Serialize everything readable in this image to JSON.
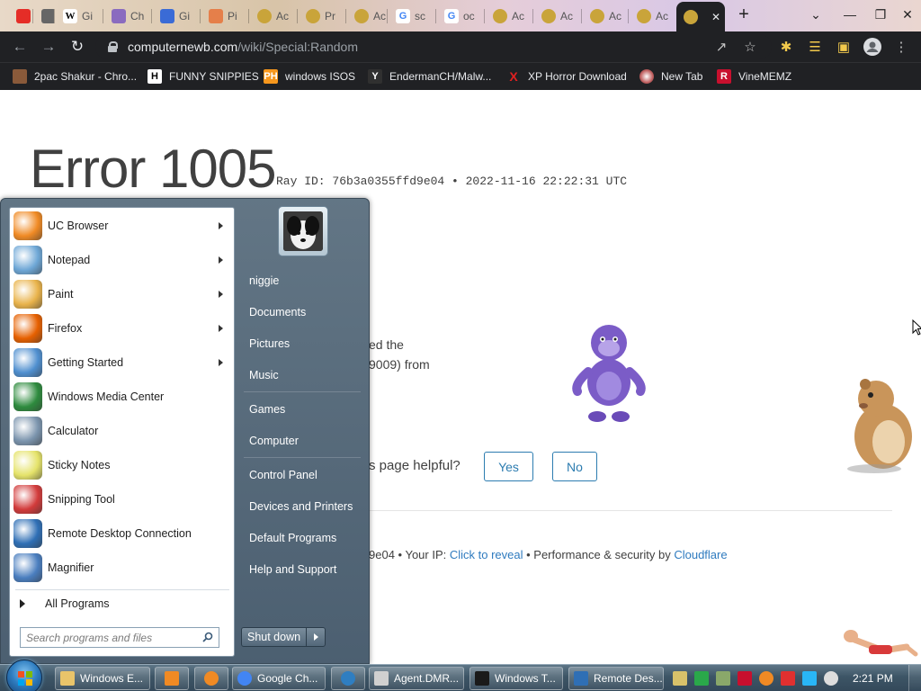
{
  "browser": {
    "address": {
      "host": "computernewb.com",
      "path": "/wiki/Special:Random"
    },
    "tabs": [
      {
        "title": "",
        "favicon": "youtube-icon",
        "color": "#e52d27"
      },
      {
        "title": "",
        "favicon": "mute-icon",
        "color": "#666666"
      },
      {
        "title": "Gi",
        "favicon": "wikipedia-icon",
        "color": "#ffffff"
      },
      {
        "title": "Ch",
        "favicon": "pen-icon",
        "color": "#8a6bbf"
      },
      {
        "title": "Gi",
        "favicon": "pen-icon",
        "color": "#3a6bd6"
      },
      {
        "title": "Pi",
        "favicon": "rainbow-icon",
        "color": "#e57f4a"
      },
      {
        "title": "Ac",
        "favicon": "cloudflare-icon",
        "color": "#c9a43a"
      },
      {
        "title": "Pr",
        "favicon": "cloudflare-icon",
        "color": "#c9a43a"
      },
      {
        "title": "Ac",
        "favicon": "cloudflare-icon",
        "color": "#c9a43a"
      },
      {
        "title": "sc",
        "favicon": "google-icon",
        "color": "#4285f4"
      },
      {
        "title": "oc",
        "favicon": "google-icon",
        "color": "#4285f4"
      },
      {
        "title": "Ac",
        "favicon": "cloudflare-icon",
        "color": "#c9a43a"
      },
      {
        "title": "Ac",
        "favicon": "cloudflare-icon",
        "color": "#c9a43a"
      },
      {
        "title": "Ac",
        "favicon": "cloudflare-icon",
        "color": "#c9a43a"
      },
      {
        "title": "Ac",
        "favicon": "cloudflare-icon",
        "color": "#c9a43a"
      },
      {
        "title": "",
        "favicon": "cloudflare-icon",
        "color": "#c9a43a",
        "active": true
      }
    ],
    "new_tab_symbol": "+",
    "close_symbol": "✕",
    "bookmarks": [
      {
        "label": "2pac Shakur - Chro...",
        "icon": "folder-person-icon",
        "color": "#8a5a3a"
      },
      {
        "label": "FUNNY SNIPPIES",
        "icon": "h-icon",
        "glyph": "H",
        "color": "#ffffff"
      },
      {
        "label": "windows ISOS",
        "icon": "ph-icon",
        "glyph": "PH",
        "color": "#f7971d"
      },
      {
        "label": "EndermanCH/Malw...",
        "icon": "yp-icon",
        "glyph": "Y",
        "color": "#303030"
      },
      {
        "label": "XP Horror Download",
        "icon": "x-icon",
        "glyph": "X",
        "color": "#e02020"
      },
      {
        "label": "New Tab",
        "icon": "globe-icon",
        "glyph": "",
        "color": "#c06060"
      },
      {
        "label": "VineMEMZ",
        "icon": "r-icon",
        "glyph": "R",
        "color": "#c8102e"
      }
    ]
  },
  "page": {
    "error_title": "Error 1005",
    "ray_id": "Ray ID: 76b3a0355ffd9e04 • 2022-11-16 22:22:31 UTC",
    "frag1": "ed the",
    "frag2": "9009) from",
    "helpful_q": "s page helpful?",
    "yes": "Yes",
    "no": "No",
    "footer_id": "9e04",
    "footer_ip": " • Your IP: ",
    "footer_reveal": "Click to reveal",
    "footer_perf": " • Performance & security by ",
    "footer_cf": "Cloudflare"
  },
  "startmenu": {
    "programs": [
      {
        "label": "UC Browser",
        "icon": "uc-browser-icon",
        "arrow": true,
        "color": "#f08a24"
      },
      {
        "label": "Notepad",
        "icon": "notepad-icon",
        "arrow": true,
        "color": "#6ea7d6"
      },
      {
        "label": "Paint",
        "icon": "paint-icon",
        "arrow": true,
        "color": "#e9b34b"
      },
      {
        "label": "Firefox",
        "icon": "firefox-icon",
        "arrow": true,
        "color": "#e66000"
      },
      {
        "label": "Getting Started",
        "icon": "getting-started-icon",
        "arrow": true,
        "color": "#4f8fcf"
      },
      {
        "label": "Windows Media Center",
        "icon": "media-center-icon",
        "arrow": false,
        "color": "#2e8b3e"
      },
      {
        "label": "Calculator",
        "icon": "calculator-icon",
        "arrow": false,
        "color": "#7b94ad"
      },
      {
        "label": "Sticky Notes",
        "icon": "sticky-notes-icon",
        "arrow": false,
        "color": "#e5e36a"
      },
      {
        "label": "Snipping Tool",
        "icon": "snipping-tool-icon",
        "arrow": false,
        "color": "#d23b3b"
      },
      {
        "label": "Remote Desktop Connection",
        "icon": "remote-desktop-icon",
        "arrow": false,
        "color": "#2f6fb5"
      },
      {
        "label": "Magnifier",
        "icon": "magnifier-icon",
        "arrow": false,
        "color": "#4a7ebf"
      }
    ],
    "all_programs": "All Programs",
    "search_placeholder": "Search programs and files",
    "right": [
      {
        "label": "niggie",
        "name": "user-name"
      },
      {
        "label": "Documents",
        "name": "documents"
      },
      {
        "label": "Pictures",
        "name": "pictures"
      },
      {
        "label": "Music",
        "name": "music"
      },
      {
        "label": "Games",
        "name": "games"
      },
      {
        "label": "Computer",
        "name": "computer"
      },
      {
        "label": "Control Panel",
        "name": "control-panel"
      },
      {
        "label": "Devices and Printers",
        "name": "devices-and-printers"
      },
      {
        "label": "Default Programs",
        "name": "default-programs"
      },
      {
        "label": "Help and Support",
        "name": "help-and-support"
      }
    ],
    "shutdown": "Shut down"
  },
  "taskbar": {
    "tasks": [
      {
        "label": "Windows E...",
        "icon": "explorer-icon",
        "color": "#e9c46a"
      },
      {
        "label": "",
        "icon": "media-player-icon",
        "color": "#f08a24"
      },
      {
        "label": "",
        "icon": "uc-browser-icon",
        "color": "#f08a24"
      },
      {
        "label": "Google Ch...",
        "icon": "chrome-icon",
        "color": "#4285f4"
      },
      {
        "label": "",
        "icon": "ie-icon",
        "color": "#2f7ec1"
      },
      {
        "label": "Agent.DMR...",
        "icon": "window-icon",
        "color": "#d0d0d0"
      },
      {
        "label": "Windows T...",
        "icon": "terminal-icon",
        "color": "#1a1a1a"
      },
      {
        "label": "Remote Des...",
        "icon": "remote-desktop-icon",
        "color": "#2f6fb5"
      }
    ],
    "tray": [
      {
        "icon": "wrench-icon",
        "color": "#d8c26a"
      },
      {
        "icon": "green-square-icon",
        "color": "#2aa84a"
      },
      {
        "icon": "grid-icon",
        "color": "#8aa86a"
      },
      {
        "icon": "v-icon",
        "color": "#c8102e"
      },
      {
        "icon": "search-tray-icon",
        "color": "#f08a24"
      },
      {
        "icon": "flag-icon",
        "color": "#e03030"
      },
      {
        "icon": "monitor-icon",
        "color": "#29b6f6"
      },
      {
        "icon": "volume-icon",
        "color": "#dddddd"
      }
    ],
    "clock": "2:21 PM"
  }
}
